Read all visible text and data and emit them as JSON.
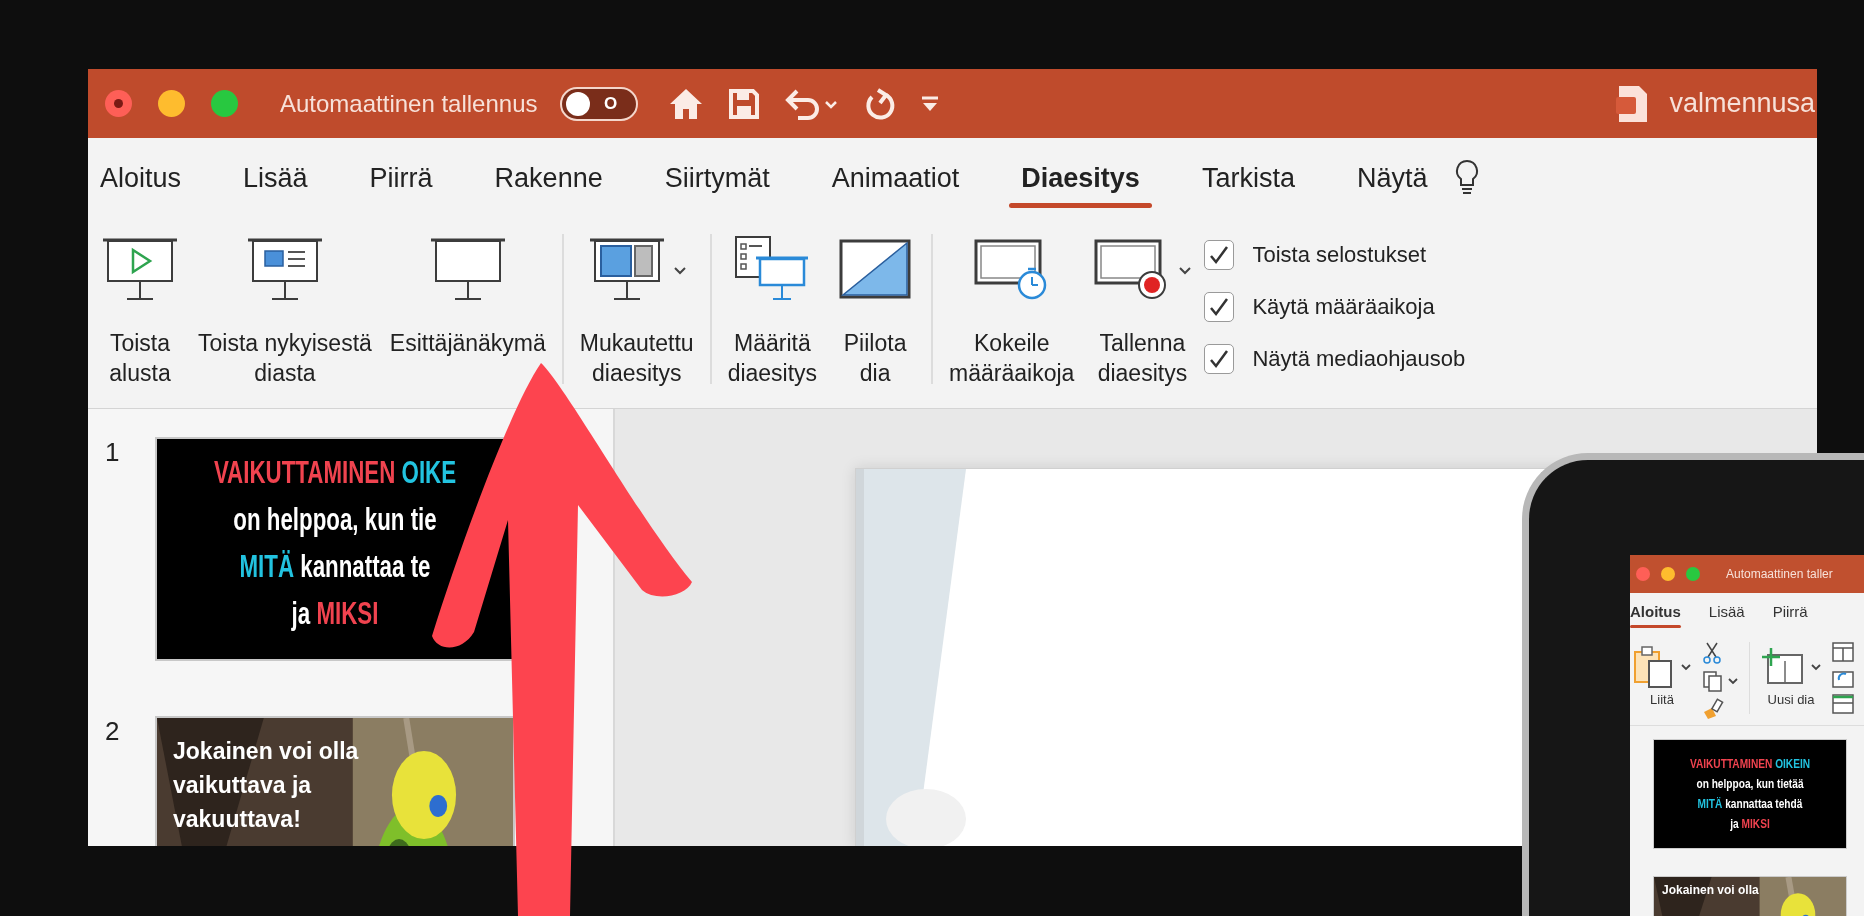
{
  "title_bar": {
    "autosave_label": "Automaattinen tallennus",
    "autosave": {
      "on": false,
      "label": "O"
    },
    "document_title": "valmennusa"
  },
  "tabs": [
    {
      "label": "Aloitus",
      "selected": false
    },
    {
      "label": "Lisää",
      "selected": false
    },
    {
      "label": "Piirrä",
      "selected": false
    },
    {
      "label": "Rakenne",
      "selected": false
    },
    {
      "label": "Siirtymät",
      "selected": false
    },
    {
      "label": "Animaatiot",
      "selected": false
    },
    {
      "label": "Diaesitys",
      "selected": true
    },
    {
      "label": "Tarkista",
      "selected": false
    },
    {
      "label": "Näytä",
      "selected": false
    }
  ],
  "ribbon": {
    "groups": [
      [
        {
          "kind": "play",
          "label": "Toista\nalusta",
          "has_menu": false
        },
        {
          "kind": "current",
          "label": "Toista nykyisestä\ndiasta",
          "has_menu": false
        },
        {
          "kind": "presenter",
          "label": "Esittäjänäkymä",
          "has_menu": false
        }
      ],
      [
        {
          "kind": "custom",
          "label": "Mukautettu\ndiaesitys",
          "has_menu": true
        }
      ],
      [
        {
          "kind": "setup",
          "label": "Määritä\ndiaesitys",
          "has_menu": false
        },
        {
          "kind": "hide",
          "label": "Piilota\ndia",
          "has_menu": false
        }
      ],
      [
        {
          "kind": "rehearse",
          "label": "Kokeile\nmääräaikoja",
          "has_menu": false
        },
        {
          "kind": "record",
          "label": "Tallenna\ndiaesitys",
          "has_menu": true
        }
      ]
    ],
    "checkboxes": [
      {
        "label": "Toista selostukset",
        "checked": true
      },
      {
        "label": "Käytä määräaikoja",
        "checked": true
      },
      {
        "label": "Näytä mediaohjausob",
        "checked": true
      }
    ]
  },
  "slides": [
    {
      "number": "1",
      "kind": "text",
      "lines": [
        [
          {
            "text": "VAIKUTTAMINEN",
            "color": "#f0434f"
          },
          {
            "text": "OIKE",
            "color": "#22c3e0"
          }
        ],
        [
          {
            "text": "on helppoa, kun tie",
            "color": "#ffffff"
          }
        ],
        [
          {
            "text": "MITÄ",
            "color": "#22c3e0"
          },
          {
            "text": "kannattaa te",
            "color": "#ffffff"
          }
        ],
        [
          {
            "text": "ja",
            "color": "#ffffff"
          },
          {
            "text": "MIKSI",
            "color": "#f0434f"
          }
        ]
      ]
    },
    {
      "number": "2",
      "lines": [
        [
          {
            "text": "Jokainen voi olla",
            "color": "#ffffff"
          }
        ],
        [
          {
            "text": "vaikuttava ja",
            "color": "#ffffff"
          }
        ],
        [
          {
            "text": "vakuuttava!",
            "color": "#ffffff"
          }
        ]
      ]
    }
  ],
  "device": {
    "title": "Automaattinen taller",
    "tabs": [
      {
        "label": "Aloitus",
        "selected": true
      },
      {
        "label": "Lisää",
        "selected": false
      },
      {
        "label": "Piirrä",
        "selected": false
      }
    ],
    "ribbon": [
      {
        "kind": "paste",
        "label": "Liitä"
      },
      {
        "kind": "clipboard-tools"
      },
      {
        "kind": "new-slide",
        "label": "Uusi dia"
      },
      {
        "kind": "slide-tools"
      }
    ],
    "slides": [
      {
        "kind": "text",
        "lines": [
          [
            {
              "text": "VAIKUTTAMINEN",
              "color": "#f0434f"
            },
            {
              "text": "OIKEIN",
              "color": "#22c3e0"
            }
          ],
          [
            {
              "text": "on helppoa, kun tietää",
              "color": "#ffffff"
            }
          ],
          [
            {
              "text": "MITÄ",
              "color": "#22c3e0"
            },
            {
              "text": "kannattaa tehdä",
              "color": "#ffffff"
            }
          ],
          [
            {
              "text": "ja",
              "color": "#ffffff"
            },
            {
              "text": "MIKSI",
              "color": "#f0434f"
            }
          ]
        ]
      },
      {
        "lines": [
          [
            {
              "text": "Jokainen voi olla",
              "color": "#ffffff"
            }
          ]
        ]
      }
    ]
  }
}
